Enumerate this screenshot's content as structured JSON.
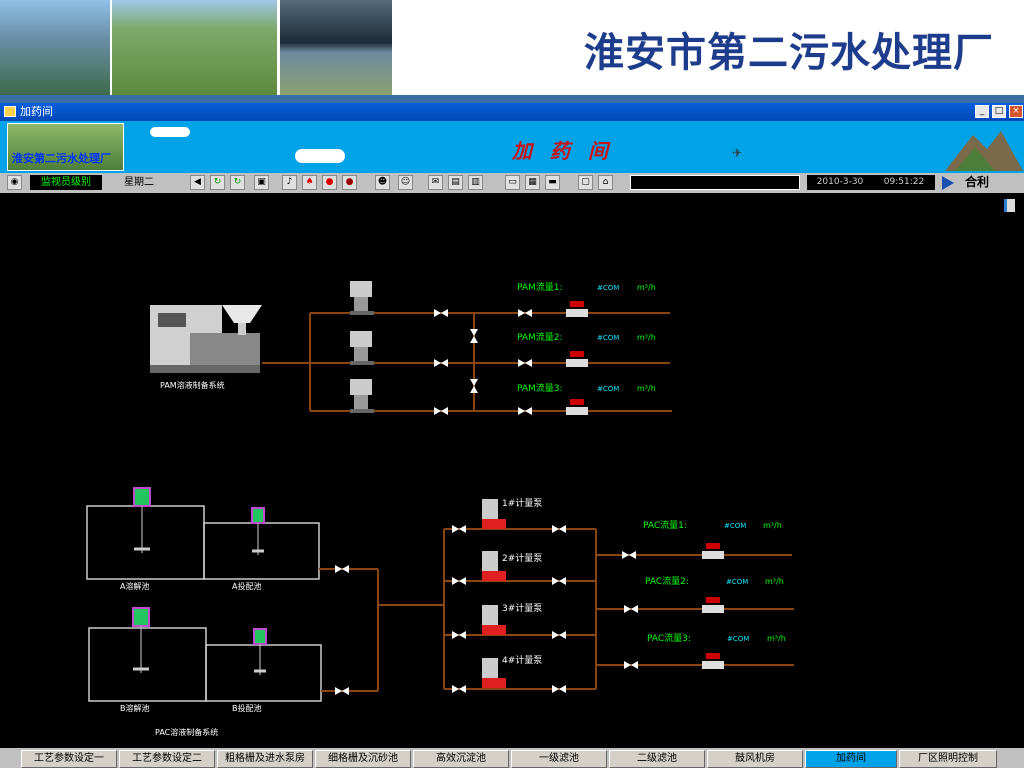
{
  "banner": {
    "title": "淮安市第二污水处理厂"
  },
  "window": {
    "title": "加药间"
  },
  "header": {
    "logo_text": "淮安第二污水处理厂",
    "title": "加药间"
  },
  "toolbar": {
    "user_label": "监视员级别",
    "weekday": "星期二",
    "date": "2010-3-30",
    "time": "09:51:22",
    "brand": "合利"
  },
  "process": {
    "pam_label": "PAM溶液制备系统",
    "pac_label": "PAC溶液制备系统",
    "pam_flows": [
      {
        "label": "PAM流量1:",
        "value": "#COM",
        "unit": "m³/h"
      },
      {
        "label": "PAM流量2:",
        "value": "#COM",
        "unit": "m³/h"
      },
      {
        "label": "PAM流量3:",
        "value": "#COM",
        "unit": "m³/h"
      }
    ],
    "pac_flows": [
      {
        "label": "PAC流量1:",
        "value": "#COM",
        "unit": "m³/h"
      },
      {
        "label": "PAC流量2:",
        "value": "#COM",
        "unit": "m³/h"
      },
      {
        "label": "PAC流量3:",
        "value": "#COM",
        "unit": "m³/h"
      }
    ],
    "tanks": [
      "A溶解池",
      "A投配池",
      "B溶解池",
      "B投配池"
    ],
    "pumps": [
      "1#计量泵",
      "2#计量泵",
      "3#计量泵",
      "4#计量泵"
    ]
  },
  "nav": {
    "items": [
      "工艺参数设定一",
      "工艺参数设定二",
      "粗格栅及进水泵房",
      "细格栅及沉砂池",
      "高效沉淀池",
      "一级滤池",
      "二级滤池",
      "鼓风机房",
      "加药间",
      "厂区照明控制"
    ],
    "active": "加药间"
  },
  "colors": {
    "pipe": "#8b4513",
    "label_green": "#00ff00",
    "value_cyan": "#00e5ff",
    "header_bg": "#00a2e8"
  }
}
